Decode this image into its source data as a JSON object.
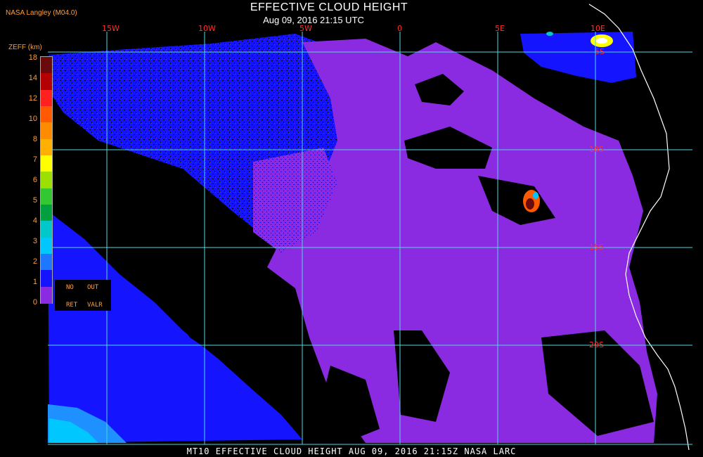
{
  "header": {
    "title": "EFFECTIVE CLOUD HEIGHT",
    "subtitle": "Aug 09, 2016 21:15 UTC",
    "credit": "NASA Langley (M04.0)"
  },
  "grid": {
    "longitudes": [
      "15W",
      "10W",
      "5W",
      "0",
      "5E",
      "10E"
    ],
    "latitudes": [
      "5S",
      "10S",
      "15S",
      "20S"
    ]
  },
  "legend": {
    "title": "ZEFF (km)",
    "ticks": [
      "18",
      "14",
      "12",
      "10",
      "8",
      "7",
      "6",
      "5",
      "4",
      "3",
      "2",
      "1",
      "0"
    ],
    "colors": [
      "#6a0a0a",
      "#b40000",
      "#ff2020",
      "#ff5a00",
      "#ff8c00",
      "#ffb000",
      "#ffff00",
      "#9be000",
      "#32c832",
      "#00a040",
      "#00c8c8",
      "#00c8ff",
      "#1e78ff",
      "#1414ff",
      "#8a2be2"
    ],
    "no_label": "NO",
    "out_label": "OUT",
    "ret_label": "RET",
    "valr_label": "VALR"
  },
  "footer": {
    "text": "MT10  EFFECTIVE CLOUD HEIGHT   AUG 09, 2016 21:15Z   NASA LARC"
  },
  "colors": {
    "low_cloud": "#8a2be2",
    "mid_cloud": "#1414ff",
    "grid": "#4fd8e0",
    "coast": "#ffffff",
    "label_red": "#ff3030",
    "label_orange": "#ff9e3a"
  }
}
